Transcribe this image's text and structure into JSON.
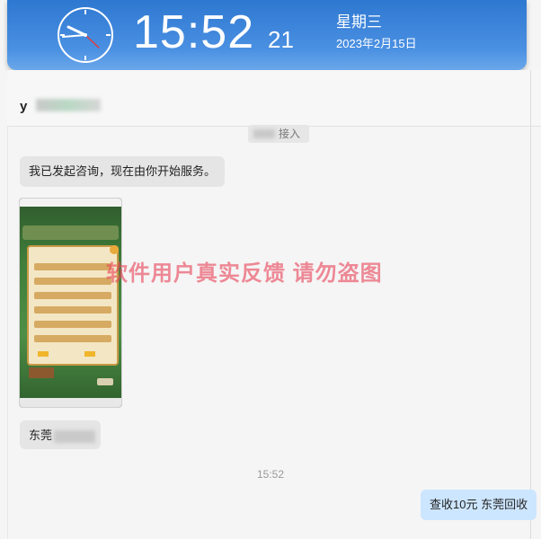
{
  "clock": {
    "time": "15:52",
    "seconds": "21",
    "weekday": "星期三",
    "date": "2023年2月15日"
  },
  "chat": {
    "contact_name": "y",
    "system_notice": "接入",
    "messages": {
      "incoming_1": "我已发起咨询，现在由你开始服务。",
      "incoming_2": "东莞",
      "timestamp": "15:52",
      "outgoing_1": "查收10元  东莞回收"
    }
  },
  "watermark": "软件用户真实反馈  请勿盗图"
}
